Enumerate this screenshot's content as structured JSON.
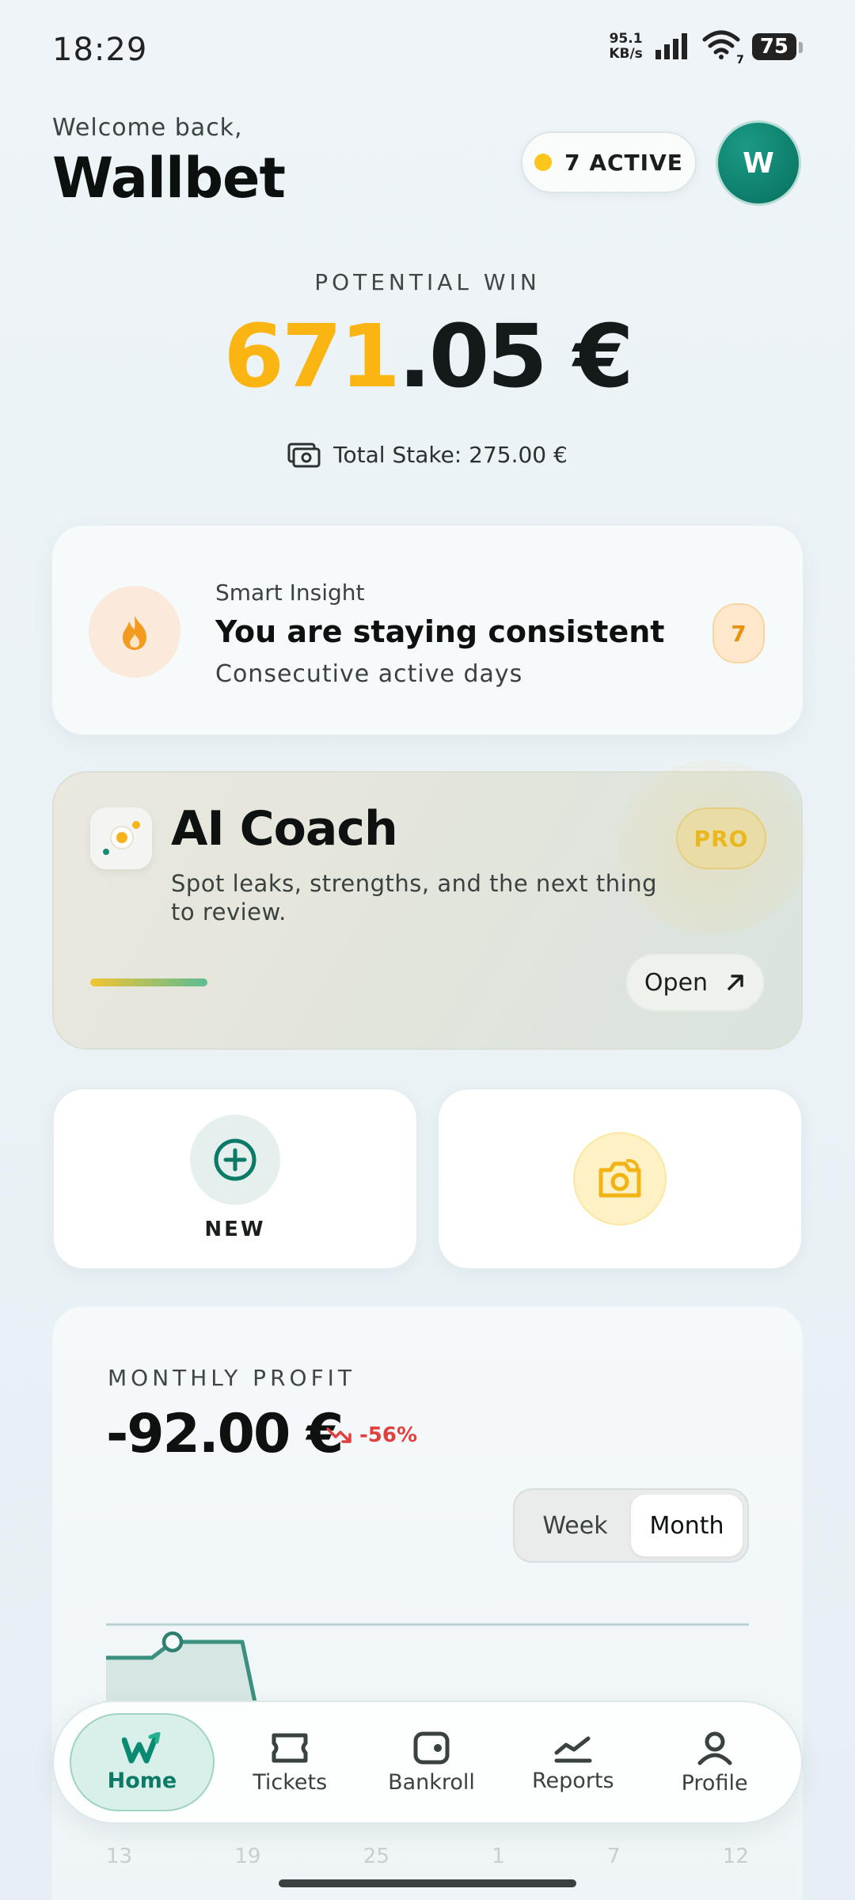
{
  "status_bar": {
    "time": "18:29",
    "net_speed": "95.1",
    "net_unit": "KB/s",
    "wifi_label": "7",
    "battery": "75"
  },
  "header": {
    "welcome": "Welcome back,",
    "brand": "Wallbet",
    "active_label": "7 ACTIVE",
    "avatar_initial": "W"
  },
  "potential_win": {
    "label": "POTENTIAL WIN",
    "amount_highlight": "671",
    "amount_rest": ".05 €",
    "total_stake": "Total Stake: 275.00 €"
  },
  "insight": {
    "kicker": "Smart Insight",
    "title": "You are staying consistent",
    "subtitle": "Consecutive active days",
    "badge": "7"
  },
  "coach": {
    "title": "AI Coach",
    "description": "Spot leaks, strengths, and the next thing to review.",
    "badge": "PRO",
    "open_label": "Open"
  },
  "actions": {
    "new_label": "NEW"
  },
  "profit": {
    "label": "MONTHLY PROFIT",
    "value": "-92.00 €",
    "change": "-56%",
    "toggle": [
      "Week",
      "Month"
    ],
    "selected": "Month",
    "x_ticks": [
      "13",
      "19",
      "25",
      "1",
      "7",
      "12"
    ]
  },
  "nav": {
    "items": [
      "Home",
      "Tickets",
      "Bankroll",
      "Reports",
      "Profile"
    ],
    "active": "Home"
  },
  "colors": {
    "accent": "#0b7a66",
    "gold": "#fbb512",
    "negative": "#e0403e"
  }
}
